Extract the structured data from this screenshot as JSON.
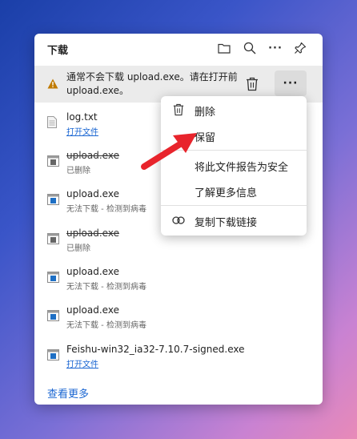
{
  "header": {
    "title": "下载",
    "icons": [
      "folder-icon",
      "search-icon",
      "more-icon",
      "pin-icon"
    ],
    "more_glyph": "···"
  },
  "warning_item": {
    "text_line1": "通常不会下载 upload.exe。请在打开前",
    "text_line2": "upload.exe。",
    "more_glyph": "···",
    "accent": "#c07a00"
  },
  "items": [
    {
      "name": "log.txt",
      "status": "打开文件",
      "struck": false,
      "link": true,
      "icon": "text-file-icon"
    },
    {
      "name": "upload.exe",
      "status": "已删除",
      "struck": true,
      "link": false,
      "icon": "exe-deleted-icon"
    },
    {
      "name": "upload.exe",
      "status": "无法下载 - 检测到病毒",
      "struck": false,
      "link": false,
      "icon": "exe-icon"
    },
    {
      "name": "upload.exe",
      "status": "已删除",
      "struck": true,
      "link": false,
      "icon": "exe-deleted-icon"
    },
    {
      "name": "upload.exe",
      "status": "无法下载 - 检测到病毒",
      "struck": false,
      "link": false,
      "icon": "exe-icon"
    },
    {
      "name": "upload.exe",
      "status": "无法下载 - 检测到病毒",
      "struck": false,
      "link": false,
      "icon": "exe-icon"
    },
    {
      "name": "Feishu-win32_ia32-7.10.7-signed.exe",
      "status": "打开文件",
      "struck": false,
      "link": true,
      "icon": "exe-icon"
    }
  ],
  "see_more": "查看更多",
  "context_menu": {
    "delete": "删除",
    "keep": "保留",
    "report_safe": "将此文件报告为安全",
    "learn_more": "了解更多信息",
    "copy_link": "复制下载链接"
  },
  "colors": {
    "link": "#1a66d2",
    "arrow": "#e8242c"
  }
}
